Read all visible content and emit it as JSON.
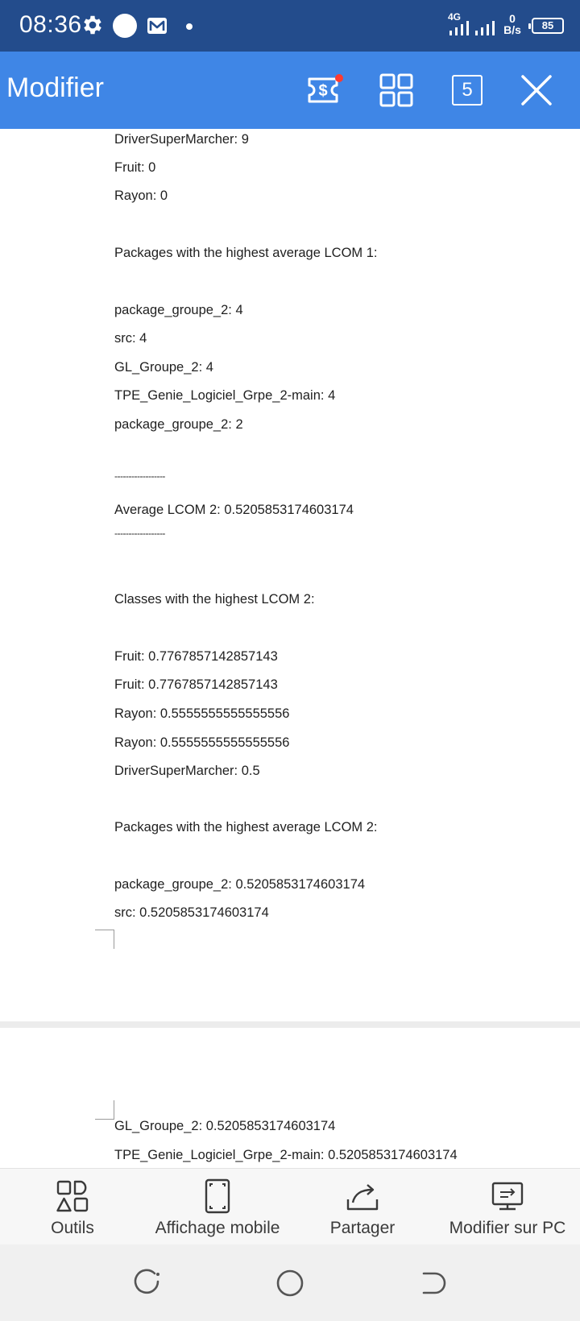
{
  "status_bar": {
    "time": "08:36",
    "network_label": "4G",
    "speed_value": "0",
    "speed_unit": "B/s",
    "battery": "85",
    "icons": [
      "gear-icon",
      "circle-notification-icon",
      "mail-icon",
      "dot-icon",
      "signal-icon",
      "signal-icon",
      "battery-icon"
    ]
  },
  "app_bar": {
    "title": "Modifier",
    "pages_count": "5",
    "icons": [
      "dollar-ticket-icon",
      "grid-icon",
      "close-icon"
    ],
    "background": "#3f86e6",
    "badge_color": "#ff3b30"
  },
  "document": {
    "page1_lines": [
      "DriverSuperMarcher: 9",
      "Fruit: 0",
      "Rayon: 0",
      "Packages with the highest average LCOM 1:",
      "package_groupe_2: 4",
      "src: 4",
      "GL_Groupe_2: 4",
      "TPE_Genie_Logiciel_Grpe_2-main: 4",
      "package_groupe_2: 2",
      "------------------",
      "Average LCOM 2: 0.5205853174603174",
      "------------------",
      "Classes with the highest LCOM 2:",
      "Fruit: 0.7767857142857143",
      "Fruit: 0.7767857142857143",
      "Rayon: 0.5555555555555556",
      "Rayon: 0.5555555555555556",
      "DriverSuperMarcher: 0.5",
      "Packages with the highest average LCOM 2:",
      "package_groupe_2: 0.5205853174603174",
      "src: 0.5205853174603174"
    ],
    "page2_lines": [
      "GL_Groupe_2: 0.5205853174603174",
      "TPE_Genie_Logiciel_Grpe_2-main: 0.5205853174603174"
    ]
  },
  "toolbar": {
    "items": [
      {
        "label": "Outils",
        "icon": "tools-icon"
      },
      {
        "label": "Affichage mobile",
        "icon": "mobile-view-icon"
      },
      {
        "label": "Partager",
        "icon": "share-icon"
      },
      {
        "label": "Modifier sur PC",
        "icon": "edit-on-pc-icon"
      }
    ]
  },
  "nav_bar": {
    "icons": [
      "recent-apps-icon",
      "home-icon",
      "back-icon"
    ]
  }
}
